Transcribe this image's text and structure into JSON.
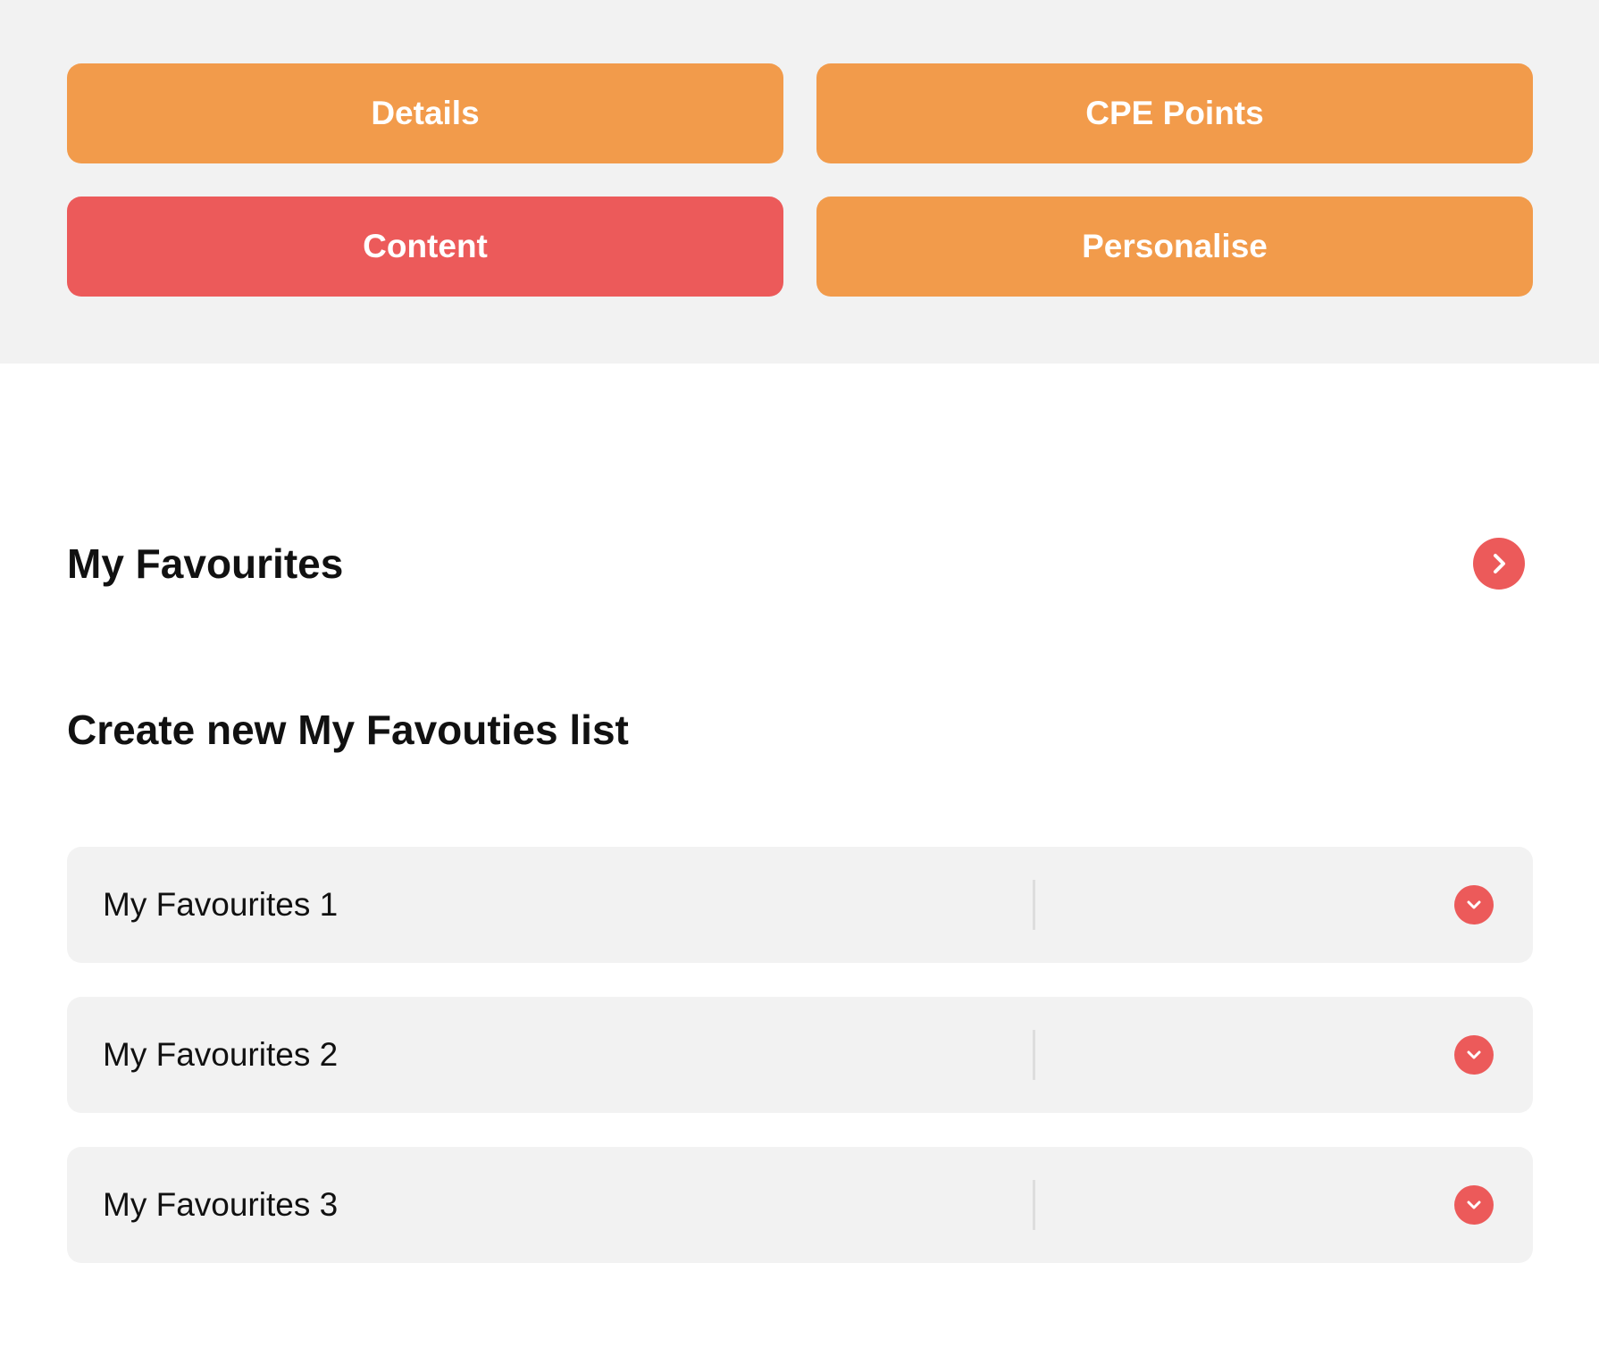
{
  "colors": {
    "primary_orange": "#f29b4b",
    "active_red": "#ec5a5a",
    "panel_grey": "#f2f2f2",
    "text_dark": "#111111"
  },
  "nav": {
    "details": "Details",
    "cpe_points": "CPE Points",
    "content": "Content",
    "personalise": "Personalise",
    "active_tab": "Content"
  },
  "favourites": {
    "title": "My Favourites",
    "arrow_icon": "chevron-right-icon"
  },
  "create_list": {
    "title": "Create new My Favouties list"
  },
  "lists": [
    {
      "label": "My Favourites 1",
      "icon": "chevron-down-icon"
    },
    {
      "label": "My Favourites 2",
      "icon": "chevron-down-icon"
    },
    {
      "label": "My Favourites 3",
      "icon": "chevron-down-icon"
    }
  ]
}
